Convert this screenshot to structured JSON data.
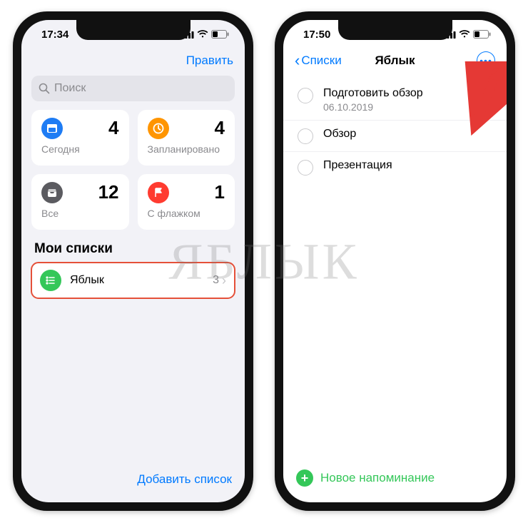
{
  "watermark": "ЯБЛЫК",
  "left_phone": {
    "status": {
      "time": "17:34"
    },
    "nav": {
      "edit": "Править"
    },
    "search": {
      "placeholder": "Поиск"
    },
    "cards": [
      {
        "icon": "calendar-icon",
        "color": "c-blue",
        "count": "4",
        "label": "Сегодня"
      },
      {
        "icon": "clock-icon",
        "color": "c-orange",
        "count": "4",
        "label": "Запланировано"
      },
      {
        "icon": "tray-icon",
        "color": "c-grey",
        "count": "12",
        "label": "Все"
      },
      {
        "icon": "flag-icon",
        "color": "c-red",
        "count": "1",
        "label": "С флажком"
      }
    ],
    "section_header": "Мои списки",
    "list": {
      "name": "Яблык",
      "count": "3"
    },
    "footer": {
      "add_list": "Добавить список"
    }
  },
  "right_phone": {
    "status": {
      "time": "17:50"
    },
    "nav": {
      "back": "Списки",
      "title": "Яблык"
    },
    "reminders": [
      {
        "title": "Подготовить обзор",
        "sub": "06.10.2019"
      },
      {
        "title": "Обзор",
        "sub": ""
      },
      {
        "title": "Презентация",
        "sub": ""
      }
    ],
    "footer": {
      "new_reminder": "Новое напоминание"
    }
  }
}
